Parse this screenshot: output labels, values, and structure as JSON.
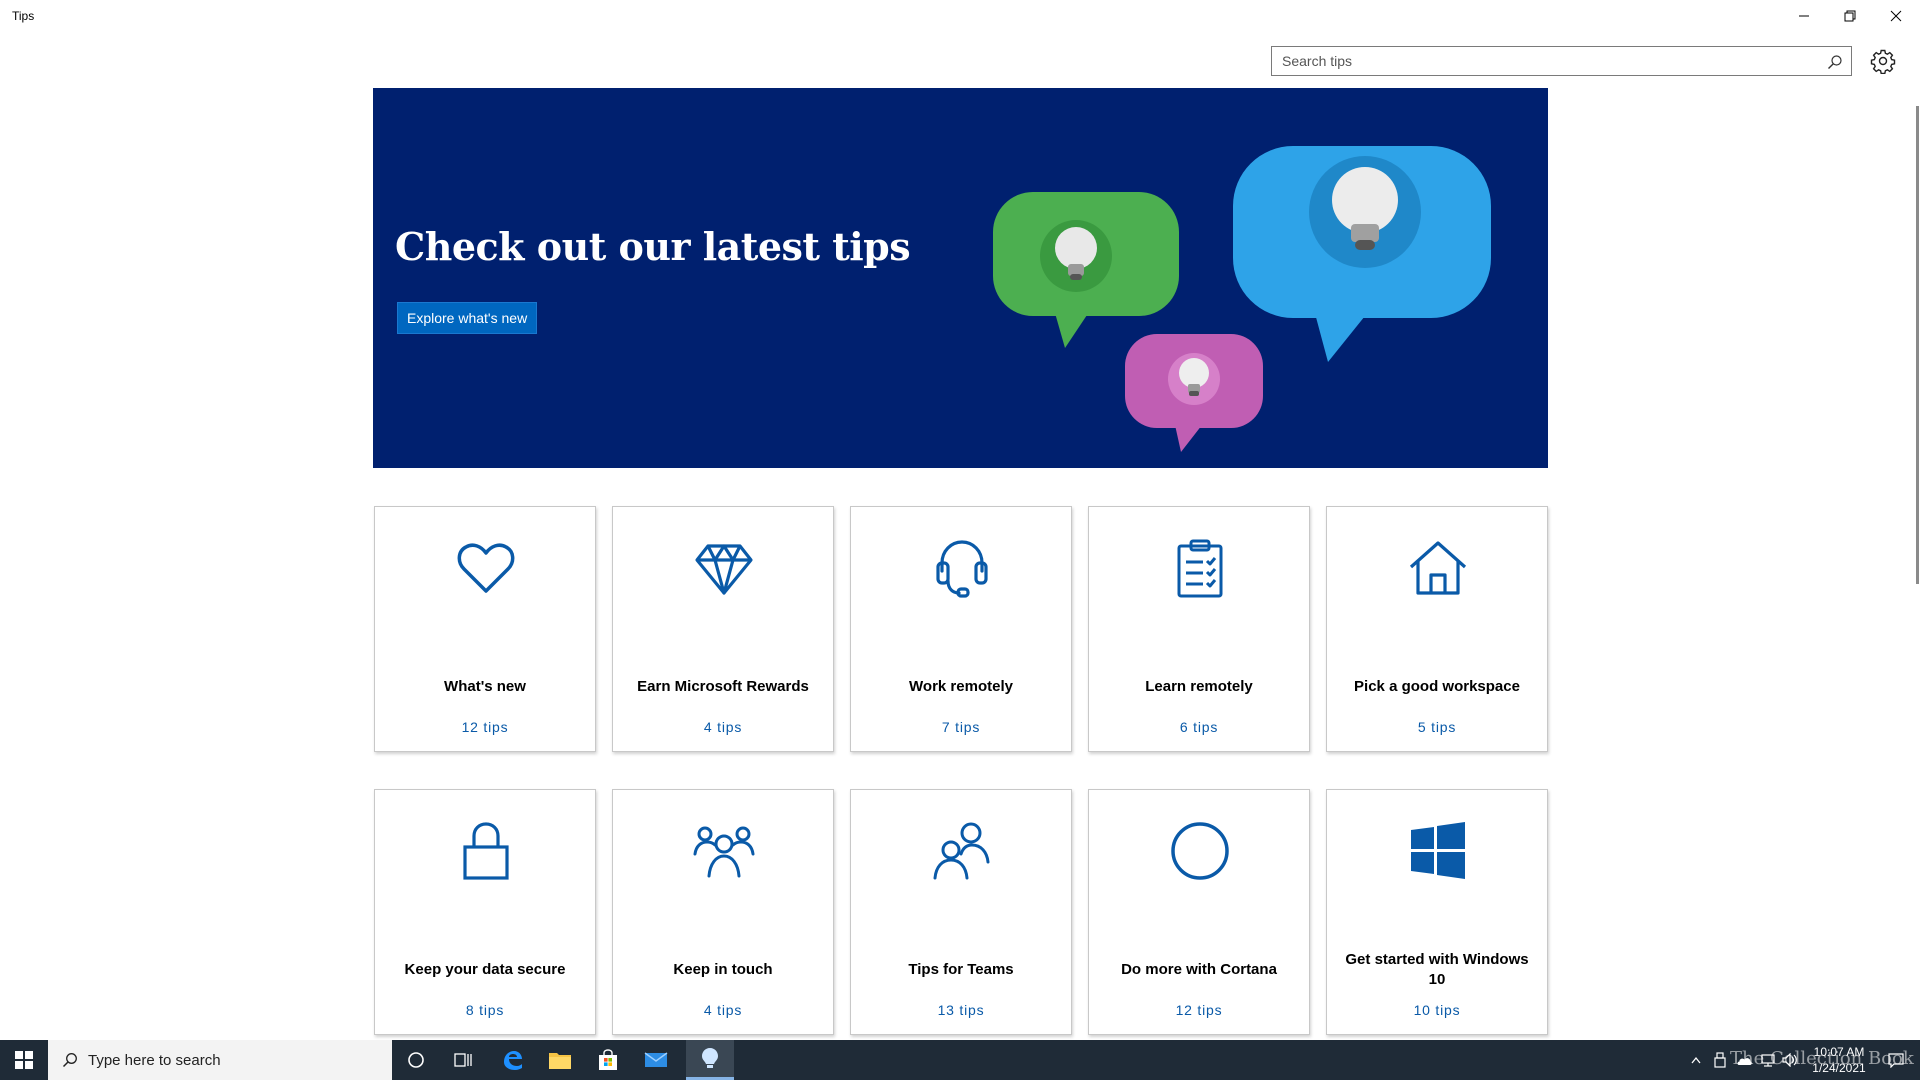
{
  "window": {
    "title": "Tips"
  },
  "search": {
    "placeholder": "Search tips"
  },
  "hero": {
    "heading": "Check out our latest tips",
    "button_label": "Explore what's new",
    "colors": {
      "background": "#00206f",
      "green": "#4caf50",
      "blue": "#2ea3e8",
      "pink": "#c05eb3"
    }
  },
  "categories": [
    {
      "title": "What's new",
      "count": "12 tips",
      "icon": "heart-icon"
    },
    {
      "title": "Earn Microsoft Rewards",
      "count": "4 tips",
      "icon": "diamond-icon"
    },
    {
      "title": "Work remotely",
      "count": "7 tips",
      "icon": "headset-icon"
    },
    {
      "title": "Learn remotely",
      "count": "6 tips",
      "icon": "clipboard-checklist-icon"
    },
    {
      "title": "Pick a good workspace",
      "count": "5 tips",
      "icon": "home-icon"
    },
    {
      "title": "Keep your data secure",
      "count": "8 tips",
      "icon": "lock-icon"
    },
    {
      "title": "Keep in touch",
      "count": "4 tips",
      "icon": "people-group-icon"
    },
    {
      "title": "Tips for Teams",
      "count": "13 tips",
      "icon": "people-pair-icon"
    },
    {
      "title": "Do more with Cortana",
      "count": "12 tips",
      "icon": "cortana-circle-icon"
    },
    {
      "title": "Get started with Windows 10",
      "count": "10 tips",
      "icon": "windows-logo-icon"
    }
  ],
  "taskbar": {
    "search_text": "Type here to search",
    "time": "10:07 AM",
    "date": "1/24/2021",
    "watermark": "The Collection Book"
  },
  "accent_color": "#0a5aa8"
}
